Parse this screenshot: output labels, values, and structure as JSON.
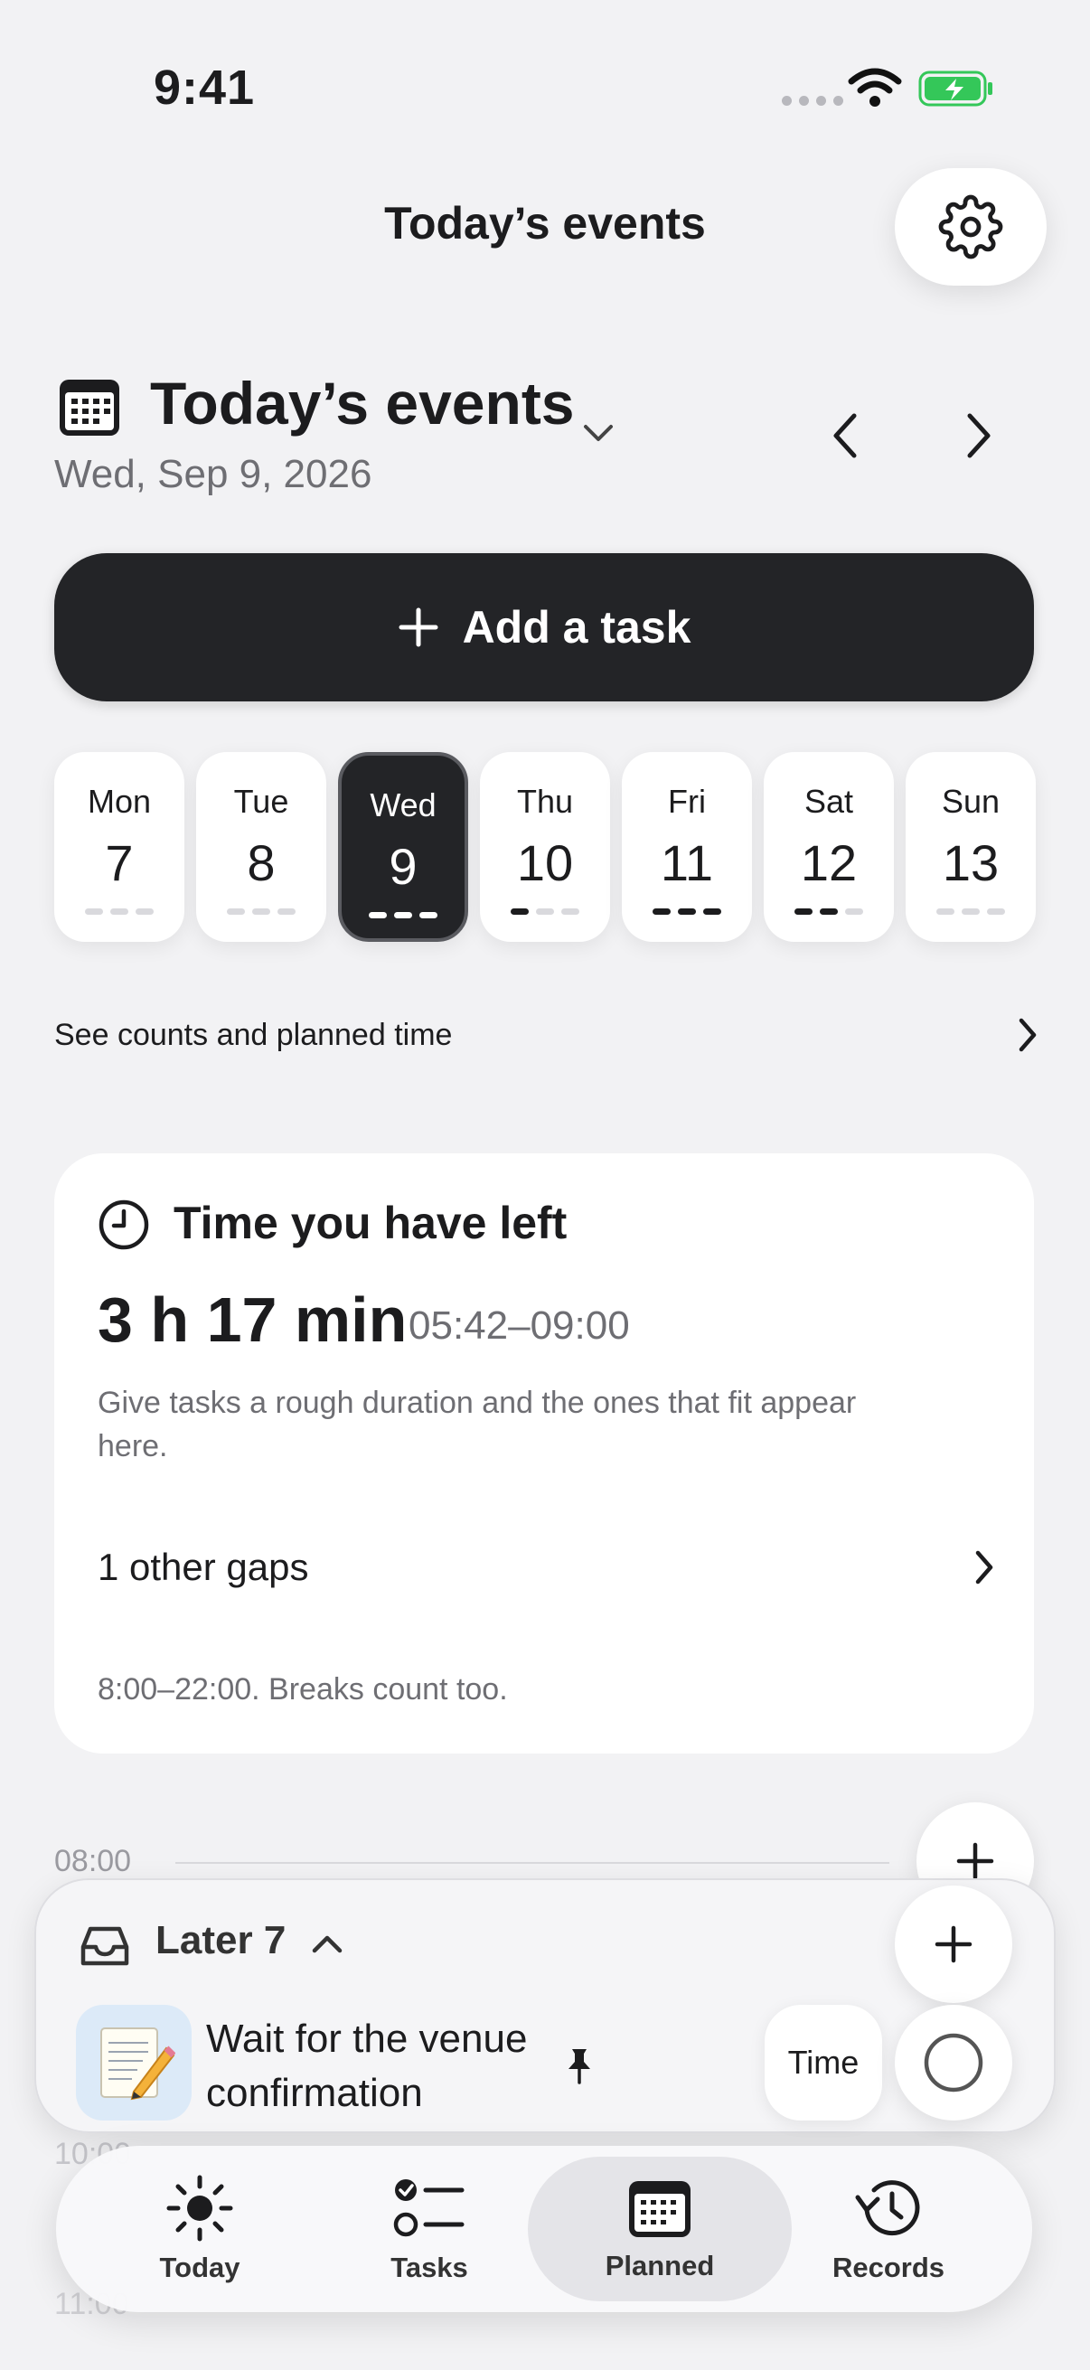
{
  "status_bar": {
    "time": "9:41"
  },
  "header": {
    "title": "Today’s events"
  },
  "section": {
    "title": "Today’s events",
    "date": "Wed, Sep 9, 2026"
  },
  "add_task": {
    "label": "Add a task"
  },
  "week": [
    {
      "name": "Mon",
      "num": "7",
      "dots": 0,
      "selected": false
    },
    {
      "name": "Tue",
      "num": "8",
      "dots": 0,
      "selected": false
    },
    {
      "name": "Wed",
      "num": "9",
      "dots": 3,
      "selected": true
    },
    {
      "name": "Thu",
      "num": "10",
      "dots": 1,
      "selected": false
    },
    {
      "name": "Fri",
      "num": "11",
      "dots": 3,
      "selected": false
    },
    {
      "name": "Sat",
      "num": "12",
      "dots": 2,
      "selected": false
    },
    {
      "name": "Sun",
      "num": "13",
      "dots": 0,
      "selected": false
    }
  ],
  "counts_link": {
    "label": "See counts and planned time"
  },
  "time_card": {
    "title": "Time you have left",
    "amount": "3 h 17 min",
    "range": "05:42–09:00",
    "description": "Give tasks a rough duration and the ones that fit appear here.",
    "gaps_label": "1 other gaps",
    "hours_note": "8:00–22:00. Breaks count too."
  },
  "timeline": {
    "labels": [
      "08:00",
      "10:00",
      "11:00"
    ]
  },
  "later": {
    "label": "Later 7",
    "task_title": "Wait for the venue confirmation",
    "task_emoji": "📝",
    "time_chip": "Time"
  },
  "nav": {
    "today": "Today",
    "tasks": "Tasks",
    "planned": "Planned",
    "records": "Records"
  },
  "colors": {
    "dark": "#232427",
    "background": "#f2f2f4",
    "battery": "#34c759"
  }
}
